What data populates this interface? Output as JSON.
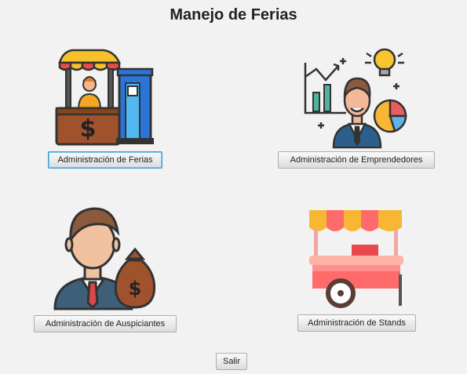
{
  "window": {
    "title": "Manejo de Ferias"
  },
  "buttons": {
    "ferias": "Administración de Ferias",
    "emprendedores": "Administración de Emprendedores",
    "auspiciantes": "Administración de Auspiciantes",
    "stands": "Administración de Stands",
    "salir": "Salir"
  },
  "icons": {
    "ferias": "market-stall-icon",
    "emprendedores": "entrepreneur-icon",
    "auspiciantes": "sponsor-money-icon",
    "stands": "food-cart-icon"
  },
  "icon_glyphs": {
    "dollar": "$"
  }
}
